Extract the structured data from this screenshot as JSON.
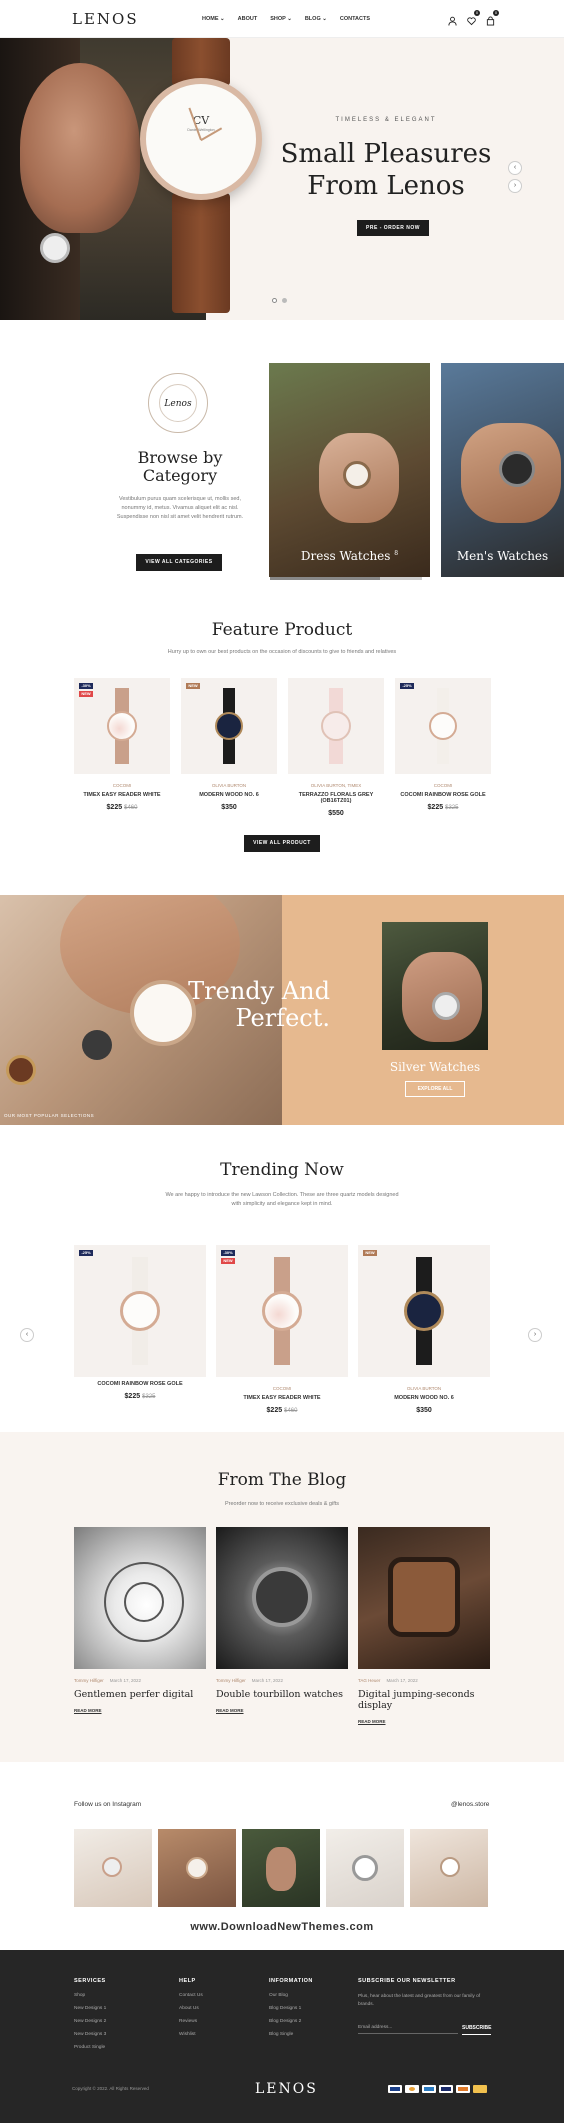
{
  "header": {
    "logo": "LENOS",
    "nav": [
      "HOME ⌄",
      "ABOUT",
      "SHOP ⌄",
      "BLOG ⌄",
      "CONTACTS"
    ],
    "wishlist_count": "0",
    "cart_count": "0"
  },
  "hero": {
    "subtitle": "TIMELESS & ELEGANT",
    "title": "Small Pleasures From Lenos",
    "button": "PRE - ORDER NOW",
    "watch_brand": "CV",
    "watch_brand_sub": "Daniel Wellington"
  },
  "browse": {
    "seal_text": "Lenos",
    "seal_ring": "LENOS WATCH · LENOS WATCH ·",
    "title": "Browse by Category",
    "text": "Vestibulum purus quam scelerisque ut, mollis sed, nonummy id, metus. Vivamus aliquet elit ac nisl. Suspendisse non nisl sit amet velit hendrerit rutrum.",
    "button": "VIEW ALL CATEGORIES",
    "categories": [
      {
        "name": "Dress Watches",
        "count": "8"
      },
      {
        "name": "Men's Watches",
        "count": ""
      }
    ]
  },
  "feature": {
    "title": "Feature Product",
    "subtitle": "Hurry up to own our best products on the occasion of discounts to give to friends and relatives",
    "button": "VIEW ALL PRODUCT",
    "products": [
      {
        "badges": [
          "-30%",
          "NEW"
        ],
        "vendor": "COCOMI",
        "name": "TIMEX EASY READER WHITE",
        "price": "$225",
        "old_price": "$460"
      },
      {
        "badges": [
          "NEW"
        ],
        "vendor": "OLIVIA BURTON",
        "name": "MODERN WOOD NO. 6",
        "price": "$350",
        "old_price": ""
      },
      {
        "badges": [],
        "vendor": "OLIVIA BURTON, TIMEX",
        "name": "TERRAZZO FLORALS GREY (OB16TZ01)",
        "price": "$550",
        "old_price": ""
      },
      {
        "badges": [
          "-25%"
        ],
        "vendor": "COCOMI",
        "name": "COCOMI RAINBOW ROSE GOLE",
        "price": "$225",
        "old_price": "$325"
      }
    ]
  },
  "banner": {
    "title": "Trendy And Perfect.",
    "caption": "OUR MOST POPULAR SELECTIONS",
    "silver_title": "Silver Watches",
    "silver_button": "EXPLORE ALL"
  },
  "trending": {
    "title": "Trending Now",
    "subtitle": "We are happy to introduce the new Lawson Collection. These are three quartz models designed with simplicity and elegance kept in mind.",
    "prev": "‹",
    "next": "›",
    "products": [
      {
        "badges": [
          "-25%"
        ],
        "vendor": "",
        "name": "COCOMI RAINBOW ROSE GOLE",
        "price": "$225",
        "old_price": "$325"
      },
      {
        "badges": [
          "-30%",
          "NEW"
        ],
        "vendor": "COCOMI",
        "name": "TIMEX EASY READER WHITE",
        "price": "$225",
        "old_price": "$460"
      },
      {
        "badges": [
          "NEW"
        ],
        "vendor": "OLIVIA BURTON",
        "name": "MODERN WOOD NO. 6",
        "price": "$350",
        "old_price": ""
      }
    ]
  },
  "blog": {
    "title": "From The Blog",
    "subtitle": "Preorder now to receive exclusive deals & gifts",
    "posts": [
      {
        "author": "Tommy Hilfiger",
        "date": "March 17, 2022",
        "title": "Gentlemen perfer digital",
        "read": "READ MORE"
      },
      {
        "author": "Tommy Hilfiger",
        "date": "March 17, 2022",
        "title": "Double tourbillon watches",
        "read": "READ MORE"
      },
      {
        "author": "TAG Heuer",
        "date": "March 17, 2022",
        "title": "Digital jumping-seconds display",
        "read": "READ MORE"
      }
    ]
  },
  "instagram": {
    "label": "Follow us on Instagram",
    "handle": "@lenos.store"
  },
  "watermark": "www.DownloadNewThemes.com",
  "footer": {
    "services": {
      "title": "SERVICES",
      "items": [
        "Shop",
        "New Designs 1",
        "New Designs 2",
        "New Designs 3",
        "Product Single"
      ]
    },
    "help": {
      "title": "HELP",
      "items": [
        "Contact Us",
        "About Us",
        "Reviews",
        "Wishlist"
      ]
    },
    "information": {
      "title": "INFORMATION",
      "items": [
        "Our Blog",
        "Blog Designs 1",
        "Blog Designs 2",
        "Blog Single"
      ]
    },
    "newsletter": {
      "title": "SUBSCRIBE OUR NEWSLETTER",
      "text": "Plus, hear about the latest and greatest from our family of brands.",
      "placeholder": "Email address...",
      "button": "SUBSCRIBE"
    },
    "copyright": "Copyright © 2022. All Rights Reserved",
    "logo": "LENOS",
    "payments": [
      "visa-icon",
      "mastercard-icon",
      "amex-icon",
      "paypal-icon",
      "discover-icon",
      "other-card-icon"
    ]
  }
}
